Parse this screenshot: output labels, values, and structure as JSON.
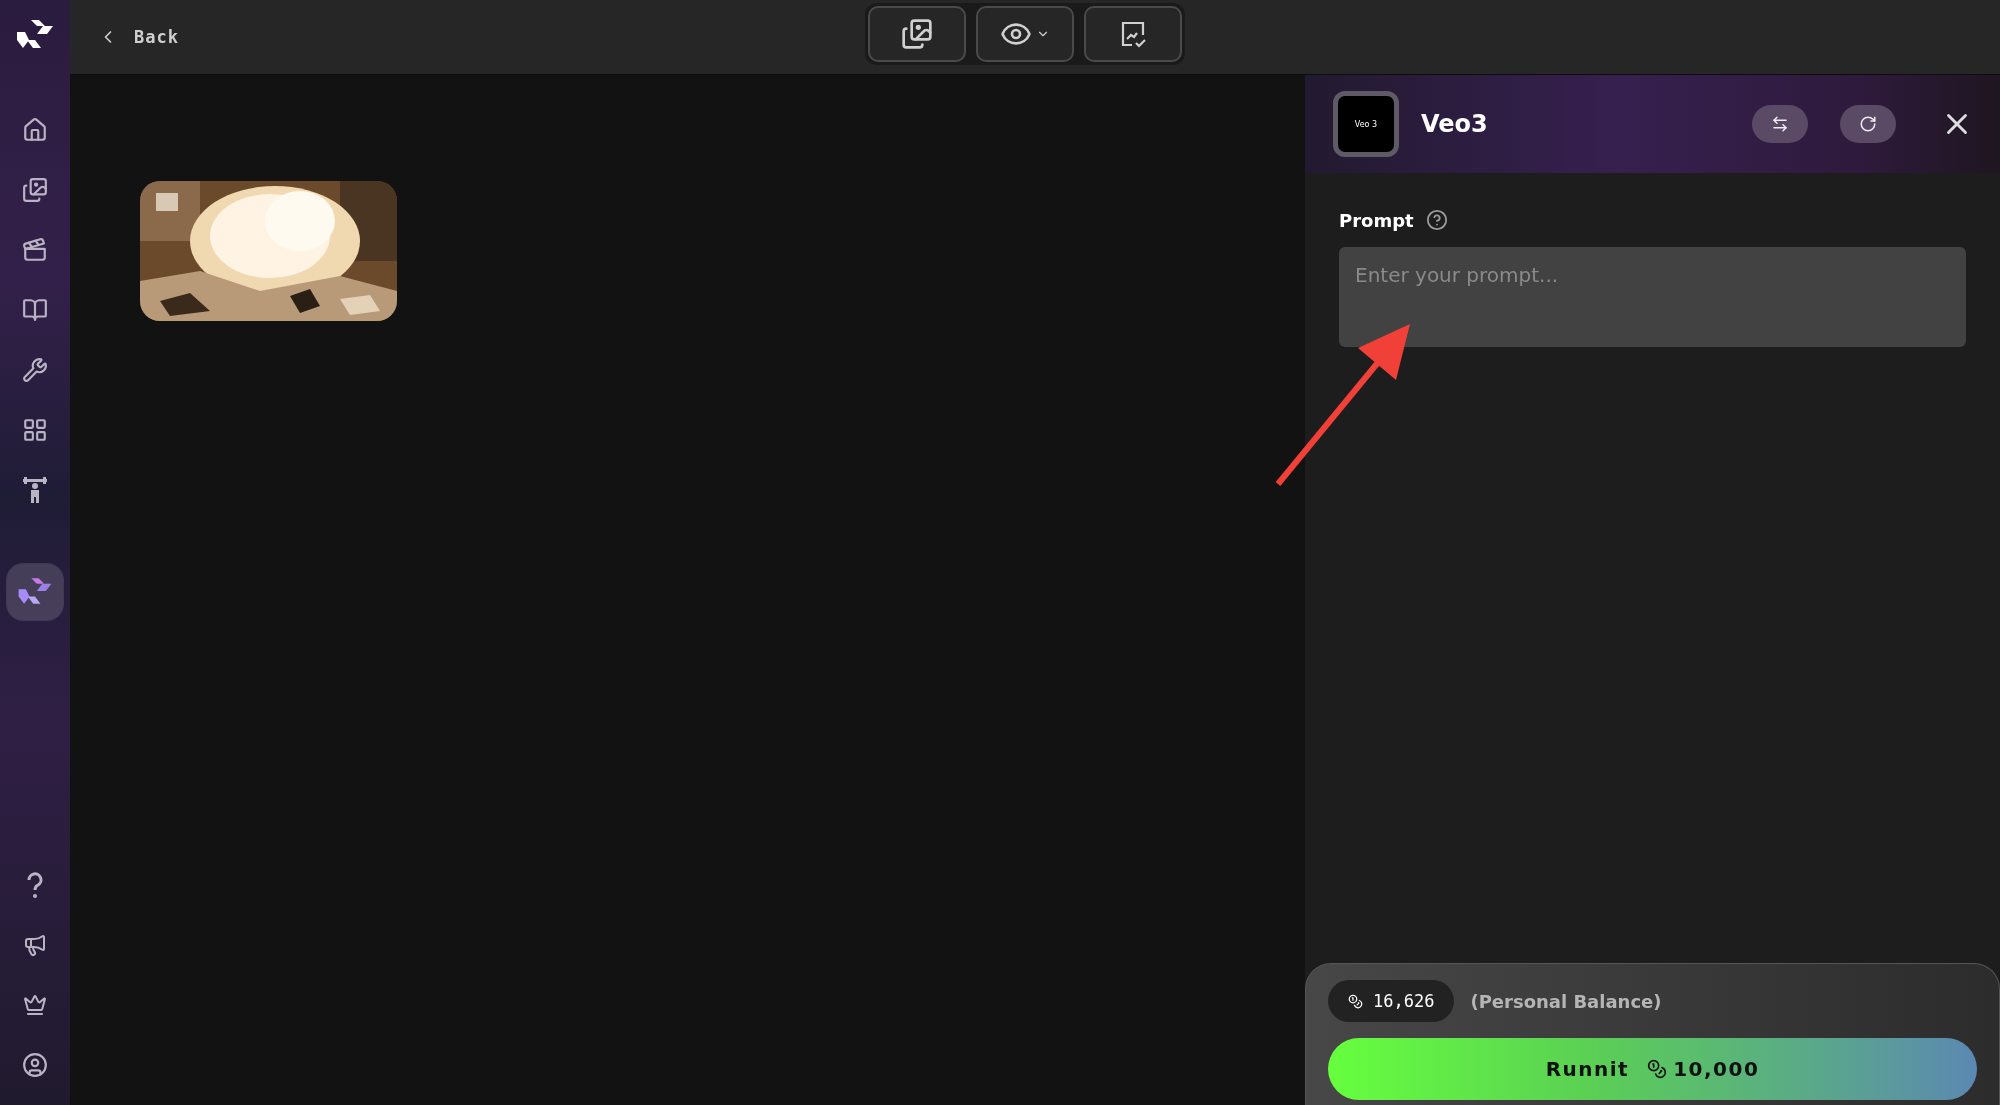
{
  "sidebar": {
    "app_button": {
      "selected": true
    }
  },
  "top_bar": {
    "back": "Back"
  },
  "panel": {
    "logo_text": "Veo 3",
    "title": "Veo3",
    "prompt_label": "Prompt",
    "prompt": {
      "placeholder": "Enter your prompt..."
    },
    "balance": "16,626",
    "balance_label": "(Personal Balance)",
    "run_label": "Runnit",
    "run_cost": "10,000"
  }
}
